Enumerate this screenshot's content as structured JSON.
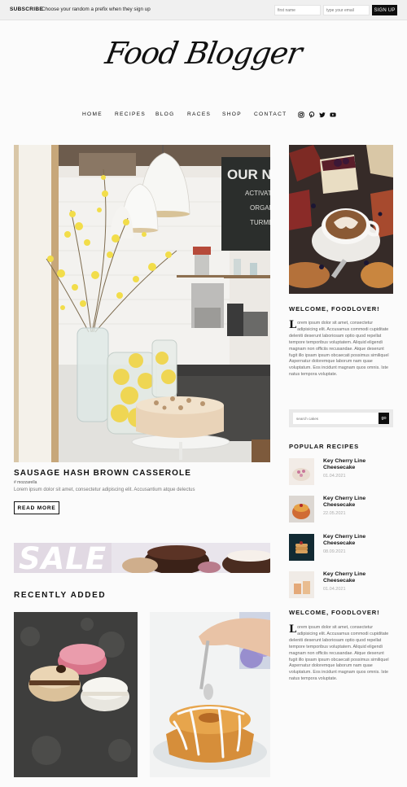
{
  "topbar": {
    "subscribe_label": "SUBSCRIBE",
    "subscribe_text": "Choose your random a prefix when they sign up",
    "first_name_placeholder": "first name",
    "email_placeholder": "type your email",
    "signup_label": "SIGN UP"
  },
  "logo": {
    "text": "Food Blogger"
  },
  "nav": {
    "items": [
      "HOME",
      "RECIPES",
      "BLOG",
      "RACES",
      "SHOP",
      "CONTACT"
    ],
    "social": [
      "instagram-icon",
      "pinterest-icon",
      "twitter-icon",
      "youtube-icon"
    ]
  },
  "hero": {
    "image_sign": "OUR NE",
    "image_sign_line2": "ACTIVAT",
    "image_sign_line3": "ORGAN",
    "image_sign_line4": "TURME",
    "title": "SAUSAGE HASH BROWN CASSEROLE",
    "tag": "# mozzarella",
    "excerpt": "Lorem ipsum dolor sit amet, consectetur adipiscing elit. Accusantium atque delectus",
    "read_more": "READ MORE"
  },
  "sale_banner": {
    "text": "SALE"
  },
  "recently_added": {
    "title": "RECENTLY ADDED"
  },
  "sidebar": {
    "welcome_title": "WELCOME, FOODLOVER!",
    "welcome_drop": "L",
    "welcome_text": "orem ipsum dolor sit amet, consectetur adipisicing elit. Accusamus commodi cupiditate deleniti deserunt laboriosam optio quod repellat tempore temporibus voluptatem. Aliquid eligendi magnam non officiis recusandae. Atque deserunt fugit illo ipsam ipsum obcaecati possimus similiquel Aspernatur doloremque laborum nam quae voluptatum. Eos incidunt magnam quos omnis. Iste natus tempora voluptate.",
    "search_placeholder": "search cakes",
    "search_button": "go",
    "popular_title": "POPULAR RECIPES",
    "recipes": [
      {
        "title": "Key Cherry Line Cheesecake",
        "date": "01.04.2021"
      },
      {
        "title": "Key Cherry Line Cheesecake",
        "date": "22.05.2021"
      },
      {
        "title": "Key Cherry Line Cheesecake",
        "date": "08.09.2021"
      },
      {
        "title": "Key Cherry Line Cheesecake",
        "date": "01.04.2021"
      }
    ],
    "welcome2_title": "WELCOME, FOODLOVER!",
    "welcome2_drop": "L",
    "welcome2_text": "orem ipsum dolor sit amet, consectetur adipisicing elit. Accusamus commodi cupiditate deleniti deserunt laboriosam optio quod repellat tempore temporibus voluptatem. Aliquid eligendi magnam non officiis recusandae. Atque deserunt fugit illo ipsam ipsum obcaecati possimus similiquel Aspernatur doloremque laborum nam quae voluptatum. Eos incidunt magnam quos omnis. Iste natus tempora voluptate."
  },
  "colors": {
    "accent": "#0d0d0d",
    "background": "#fbfbfb",
    "muted_text": "#777777",
    "date_text": "#aaaaaa"
  }
}
